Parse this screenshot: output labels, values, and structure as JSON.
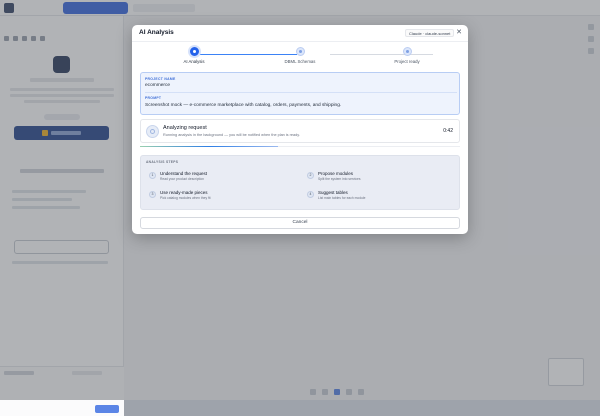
{
  "app": {
    "brand": "",
    "top_tab": ""
  },
  "modal": {
    "title": "AI Analysis",
    "model_chip": "Claude · claude-sonnet",
    "close_icon": "close-icon",
    "steps": [
      {
        "label": "AI Analysis",
        "state": "current"
      },
      {
        "label": "DBML Schemas",
        "state": "pending"
      },
      {
        "label": "Project ready",
        "state": "pending"
      }
    ],
    "project": {
      "name_label": "PROJECT NAME",
      "name_value": "ecommerce",
      "prompt_label": "PROMPT",
      "prompt_value": "Screenshot mock — e-commerce marketplace with catalog, orders, payments, and shipping."
    },
    "analyzing": {
      "title": "Analyzing request",
      "subtitle": "Running analysis in the background — you will be notified when the plan is ready.",
      "timer": "0:42",
      "progress": 0.43
    },
    "analysis_steps": {
      "label": "ANALYSIS STEPS",
      "items": [
        {
          "num": "1",
          "title": "Understand the request",
          "desc": "Read your product description"
        },
        {
          "num": "2",
          "title": "Propose modules",
          "desc": "Split the system into services"
        },
        {
          "num": "3",
          "title": "Use ready-made pieces",
          "desc": "Pick catalog modules when they fit"
        },
        {
          "num": "4",
          "title": "Suggest tables",
          "desc": "List main tables for each module"
        }
      ]
    },
    "cancel_label": "Cancel"
  },
  "colors": {
    "accent": "#2563eb",
    "overlay": "#464a52",
    "card_bg": "#eef3fd"
  }
}
